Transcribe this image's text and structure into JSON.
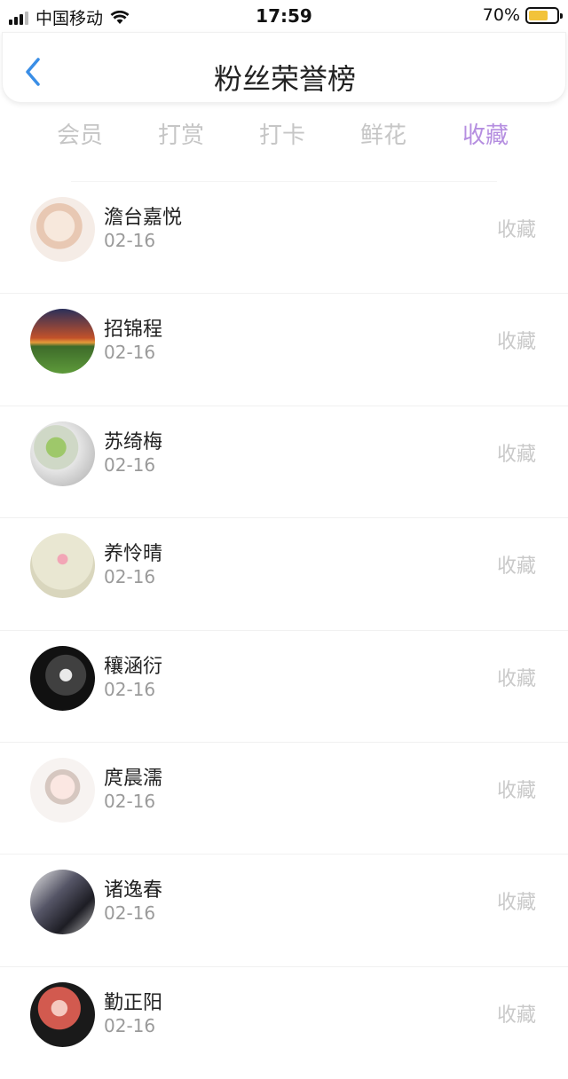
{
  "status": {
    "carrier": "中国移动",
    "time": "17:59",
    "battery": "70%",
    "battery_level": 0.7,
    "battery_color": "#f2c33a"
  },
  "nav": {
    "title": "粉丝荣誉榜"
  },
  "tabs": [
    "会员",
    "打赏",
    "打卡",
    "鲜花",
    "收藏"
  ],
  "active_tab": "收藏",
  "accent_color": "#b58ee0",
  "rows": [
    {
      "name": "澹台嘉悦",
      "date": "02-16",
      "action": "收藏"
    },
    {
      "name": "招锦程",
      "date": "02-16",
      "action": "收藏"
    },
    {
      "name": "苏绮梅",
      "date": "02-16",
      "action": "收藏"
    },
    {
      "name": "养怜晴",
      "date": "02-16",
      "action": "收藏"
    },
    {
      "name": "穰涵衍",
      "date": "02-16",
      "action": "收藏"
    },
    {
      "name": "庹晨濡",
      "date": "02-16",
      "action": "收藏"
    },
    {
      "name": "诸逸春",
      "date": "02-16",
      "action": "收藏"
    },
    {
      "name": "勤正阳",
      "date": "02-16",
      "action": "收藏"
    }
  ]
}
